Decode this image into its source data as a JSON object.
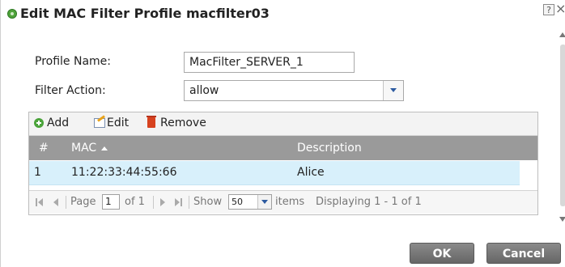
{
  "dialog": {
    "title": "Edit MAC Filter Profile macfilter03",
    "help_label": "?",
    "close_label": "×"
  },
  "form": {
    "profile_name_label": "Profile Name:",
    "profile_name_value": "MacFilter_SERVER_1",
    "filter_action_label": "Filter Action:",
    "filter_action_value": "allow"
  },
  "toolbar": {
    "add_label": "Add",
    "edit_label": "Edit",
    "remove_label": "Remove"
  },
  "table": {
    "columns": [
      "#",
      "MAC",
      "Description"
    ],
    "rows": [
      {
        "index": "1",
        "mac": "11:22:33:44:55:66",
        "description": "Alice"
      }
    ]
  },
  "pager": {
    "page_label": "Page",
    "page_value": "1",
    "of_label": "of 1",
    "show_label": "Show",
    "show_value": "50",
    "items_label": "items",
    "displaying": "Displaying 1 - 1 of 1"
  },
  "buttons": {
    "ok_label": "OK",
    "cancel_label": "Cancel"
  }
}
